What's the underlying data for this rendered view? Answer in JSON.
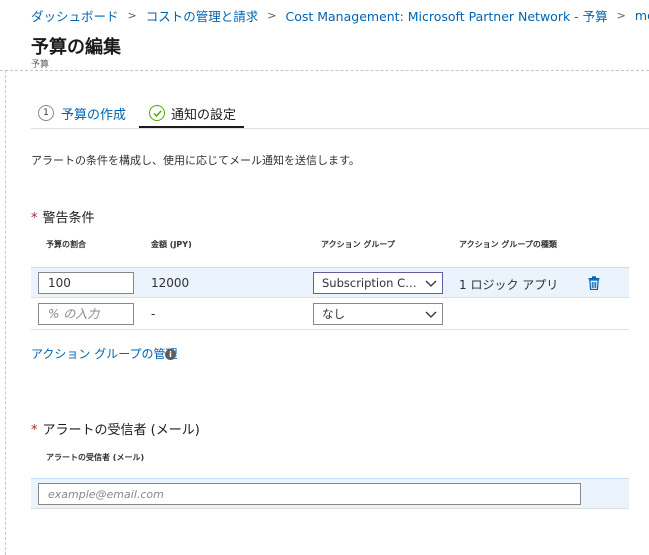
{
  "breadcrumb": [
    {
      "label": "ダッシュボード"
    },
    {
      "label": "コストの管理と請求"
    },
    {
      "label": "Cost Management: Microsoft Partner Network - 予算"
    },
    {
      "label": "monthly-alert"
    }
  ],
  "page": {
    "title": "予算の編集",
    "subtitle": "予算"
  },
  "tabs": [
    {
      "step": "1",
      "label": "予算の作成"
    },
    {
      "label": "通知の設定"
    }
  ],
  "description": "アラートの条件を構成し、使用に応じてメール通知を送信します。",
  "alert_conditions": {
    "required_mark": "*",
    "title": "警告条件",
    "columns": [
      "予算の割合",
      "金額 (JPY)",
      "アクション グループ",
      "アクション グループの種類"
    ],
    "rows": [
      {
        "percent": "100",
        "amount": "12000",
        "action_group": "Subscription Cos...",
        "type": "1 ロジック アプリ"
      },
      {
        "percent_placeholder": "% の入力",
        "amount": "-",
        "action_group": "なし",
        "type": ""
      }
    ]
  },
  "manage_link": "アクション グループの管理",
  "recipients": {
    "required_mark": "*",
    "title": "アラートの受信者 (メール)",
    "column": "アラートの受信者 (メール)",
    "placeholder": "example@email.com"
  },
  "colors": {
    "link": "#0064b4",
    "selected_row": "#ebf3fc",
    "required": "#a4262c",
    "check": "#57a300"
  }
}
